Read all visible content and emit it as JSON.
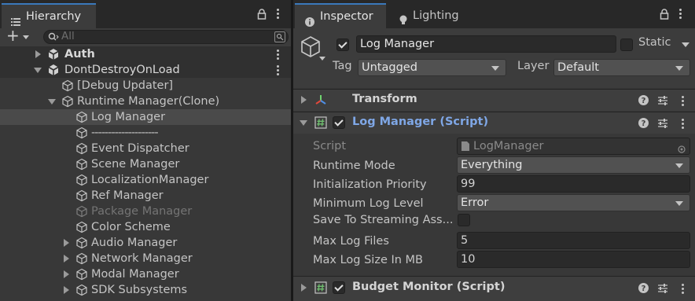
{
  "hierarchy": {
    "tab_label": "Hierarchy",
    "search_placeholder": "All",
    "add_label": "+",
    "items": [
      {
        "label": "Auth"
      },
      {
        "label": "DontDestroyOnLoad"
      },
      {
        "label": "[Debug Updater]"
      },
      {
        "label": "Runtime Manager(Clone)"
      },
      {
        "label": "Log Manager"
      },
      {
        "label": "--------------------"
      },
      {
        "label": "Event Dispatcher"
      },
      {
        "label": "Scene Manager"
      },
      {
        "label": "LocalizationManager"
      },
      {
        "label": "Ref Manager"
      },
      {
        "label": "Package Manager"
      },
      {
        "label": "Color Scheme"
      },
      {
        "label": "Audio Manager"
      },
      {
        "label": "Network Manager"
      },
      {
        "label": "Modal Manager"
      },
      {
        "label": "SDK Subsystems"
      }
    ]
  },
  "inspector": {
    "tab_label": "Inspector",
    "lighting_tab_label": "Lighting",
    "object_name": "Log Manager",
    "static_label": "Static",
    "tag_label": "Tag",
    "tag_value": "Untagged",
    "layer_label": "Layer",
    "layer_value": "Default",
    "components": {
      "transform": "Transform",
      "log_manager": "Log Manager (Script)",
      "budget_monitor": "Budget Monitor (Script)"
    },
    "properties": {
      "script_label": "Script",
      "script_value": "LogManager",
      "runtime_mode_label": "Runtime Mode",
      "runtime_mode_value": "Everything",
      "init_priority_label": "Initialization Priority",
      "init_priority_value": "99",
      "min_log_level_label": "Minimum Log Level",
      "min_log_level_value": "Error",
      "save_streaming_label": "Save To Streaming Ass...",
      "max_log_files_label": "Max Log Files",
      "max_log_files_value": "5",
      "max_log_size_label": "Max Log Size In MB",
      "max_log_size_value": "10"
    }
  },
  "colors": {
    "accent": "#3a79bb",
    "script_title": "#7fa7e6",
    "panel_bg": "#383838"
  },
  "icons": [
    "hamburger-icon",
    "lock-icon",
    "kebab-menu-icon",
    "search-icon",
    "cube-icon",
    "unity-scene-icon",
    "info-icon",
    "bulb-icon",
    "help-icon",
    "preset-icon",
    "transform-icon",
    "script-hash-icon",
    "object-picker-icon"
  ]
}
